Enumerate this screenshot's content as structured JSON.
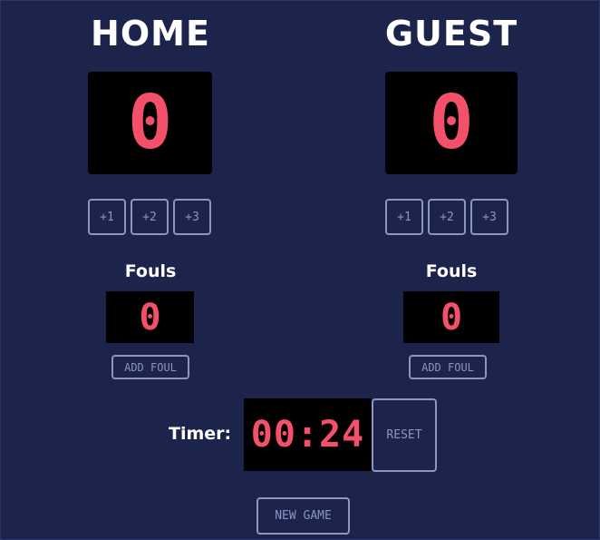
{
  "home": {
    "title": "HOME",
    "score": "0",
    "buttons": [
      "+1",
      "+2",
      "+3"
    ],
    "fouls_label": "Fouls",
    "fouls": "0",
    "add_foul_label": "ADD FOUL"
  },
  "guest": {
    "title": "GUEST",
    "score": "0",
    "buttons": [
      "+1",
      "+2",
      "+3"
    ],
    "fouls_label": "Fouls",
    "fouls": "0",
    "add_foul_label": "ADD FOUL"
  },
  "timer": {
    "label": "Timer:",
    "value": "00:24",
    "reset_label": "RESET"
  },
  "new_game_label": "NEW GAME",
  "colors": {
    "background": "#1c244b",
    "digit": "#f4506a",
    "button_border": "#8b95c6"
  }
}
